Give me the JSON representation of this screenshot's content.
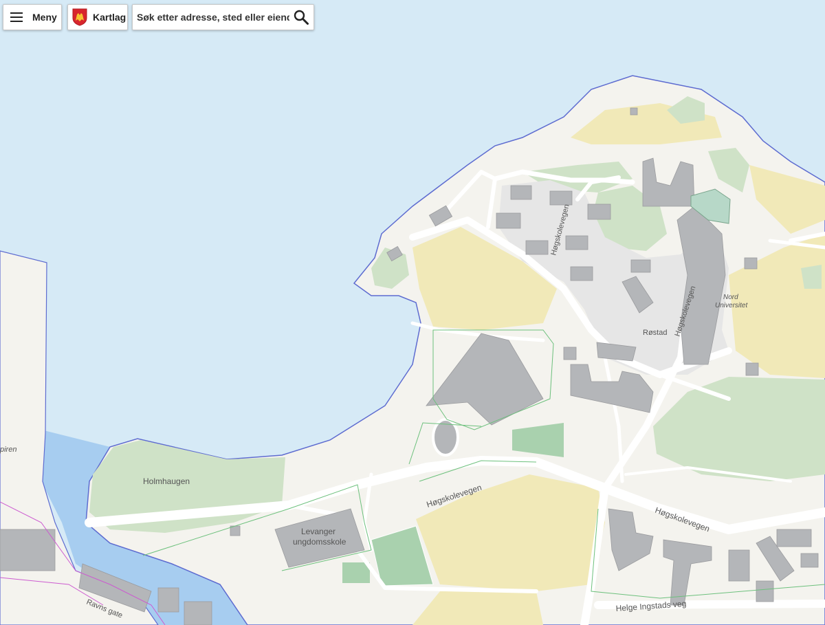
{
  "toolbar": {
    "menu_label": "Meny",
    "layers_label": "Kartlag",
    "search": {
      "placeholder": "Søk etter adresse, sted eller eiendom",
      "value": ""
    }
  },
  "map": {
    "labels": {
      "holmhaugen": "Holmhaugen",
      "levanger_1": "Levanger",
      "levanger_2": "ungdomsskole",
      "hogskolevegen": "Høgskolevegen",
      "rostad": "Røstad",
      "nord_1": "Nord",
      "nord_2": "Universitet",
      "helge_ingstads_veg": "Helge Ingstads veg",
      "ravns_gate": "Ravns gate",
      "piren": "piren"
    },
    "colors": {
      "water": "#d6eaf6",
      "river": "#a7cdf0",
      "land": "#f4f3ee",
      "field": "#f1e9b8",
      "forest": "#cfe2c7",
      "building": "#b4b6b9",
      "road": "#ffffff",
      "coast": "#5d6bd0"
    }
  }
}
